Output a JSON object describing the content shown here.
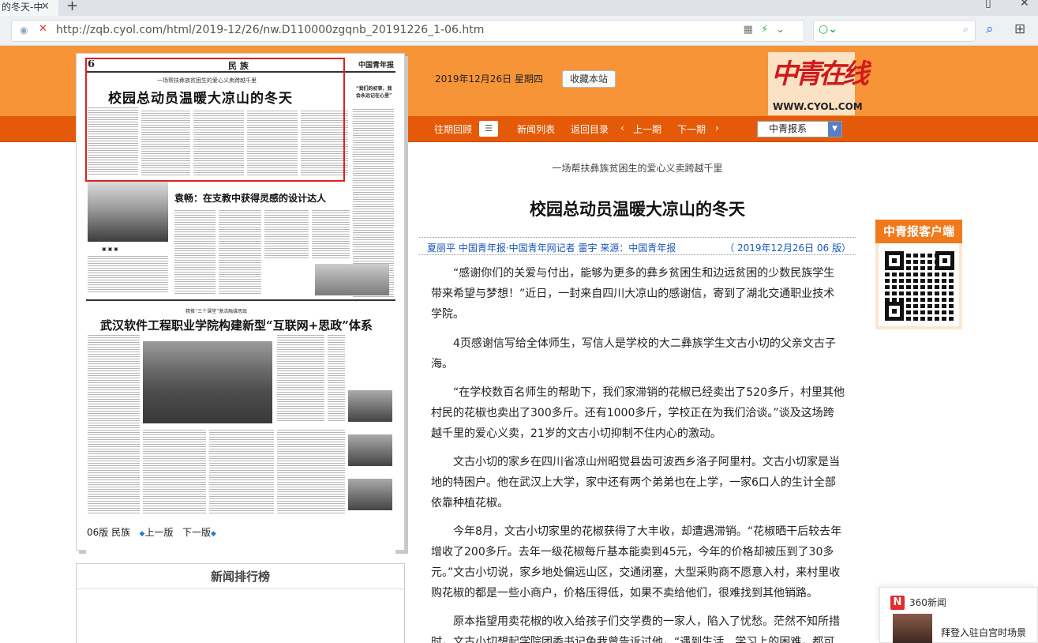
{
  "browser": {
    "tab_title": "的冬天-中",
    "tab_close": "✕",
    "new_tab": "+",
    "url": "http://zqb.cyol.com/html/2019-12/26/nw.D110000zgqnb_20191226_1-06.htm"
  },
  "header": {
    "date": "2019年12月26日  星期四",
    "bookmark_label": "收藏本站",
    "logo_mark": "中青在线",
    "logo_url": "WWW.CYOL.COM"
  },
  "nav": {
    "history": "往期回顾",
    "news_list": "新闻列表",
    "back_to_index": "返回目录",
    "prev": "上一期",
    "next": "下一期",
    "paper_select": "中青报系"
  },
  "newspaper": {
    "page_num": "6",
    "section": "民 族",
    "brand": "中国青年报",
    "kicker": "一场帮扶彝族贫困生的爱心义卖跨越千里",
    "title": "校园总动员温暖大凉山的冬天",
    "side_title": "“我们的初衷，我会永远记在心里”",
    "title2": "袁畅：在支教中获得灵感的设计达人",
    "kicker3": "精推“三个课堂”激活融媒思政",
    "title3": "武汉软件工程职业学院构建新型“互联网+思政”体系",
    "page_label": "06版 民族",
    "prev_page": "上一版",
    "next_page": "下一版"
  },
  "ranking": {
    "title": "新闻排行榜"
  },
  "article": {
    "subhead": "一场帮扶彝族贫困生的爱心义卖跨越千里",
    "headline": "校园总动员温暖大凉山的冬天",
    "byline": "夏丽平  中国青年报·中国青年网记者  雷宇      来源：中国青年报",
    "date": "（ 2019年12月26日    06 版）",
    "paragraphs": [
      "“感谢你们的关爱与付出，能够为更多的彝乡贫困生和边远贫困的少数民族学生带来希望与梦想！”近日，一封来自四川大凉山的感谢信，寄到了湖北交通职业技术学院。",
      "4页感谢信写给全体师生，写信人是学校的大二彝族学生文古小切的父亲文古子海。",
      "“在学校数百名师生的帮助下，我们家滞销的花椒已经卖出了520多斤，村里其他村民的花椒也卖出了300多斤。还有1000多斤，学校正在为我们洽谈。”谈及这场跨越千里的爱心义卖，21岁的文古小切抑制不住内心的激动。",
      "文古小切的家乡在四川省凉山州昭觉县齿可波西乡洛子阿里村。文古小切家是当地的特困户。他在武汉上大学，家中还有两个弟弟也在上学，一家6口人的生计全部依靠种植花椒。",
      "今年8月，文古小切家里的花椒获得了大丰收，却遭遇滞销。“花椒晒干后较去年增收了200多斤。去年一级花椒每斤基本能卖到45元，今年的价格却被压到了30多元。”文古小切说，家乡地处偏远山区，交通闭塞，大型采购商不愿意入村，来村里收购花椒的都是一些小商户，价格压得低，如果不卖给他们，很难找到其他销路。",
      "原本指望用卖花椒的收入给孩子们交学费的一家人，陷入了忧愁。茫然不知所措时，文古小切想起学院团委书记兔我曾告诉过他，“遇到生活、学习上的困难，都可"
    ]
  },
  "app_box": {
    "title": "中青报客户端"
  },
  "news360": {
    "brand_letter": "N",
    "title": "360新闻",
    "headline": "拜登入驻白宫时场景"
  }
}
